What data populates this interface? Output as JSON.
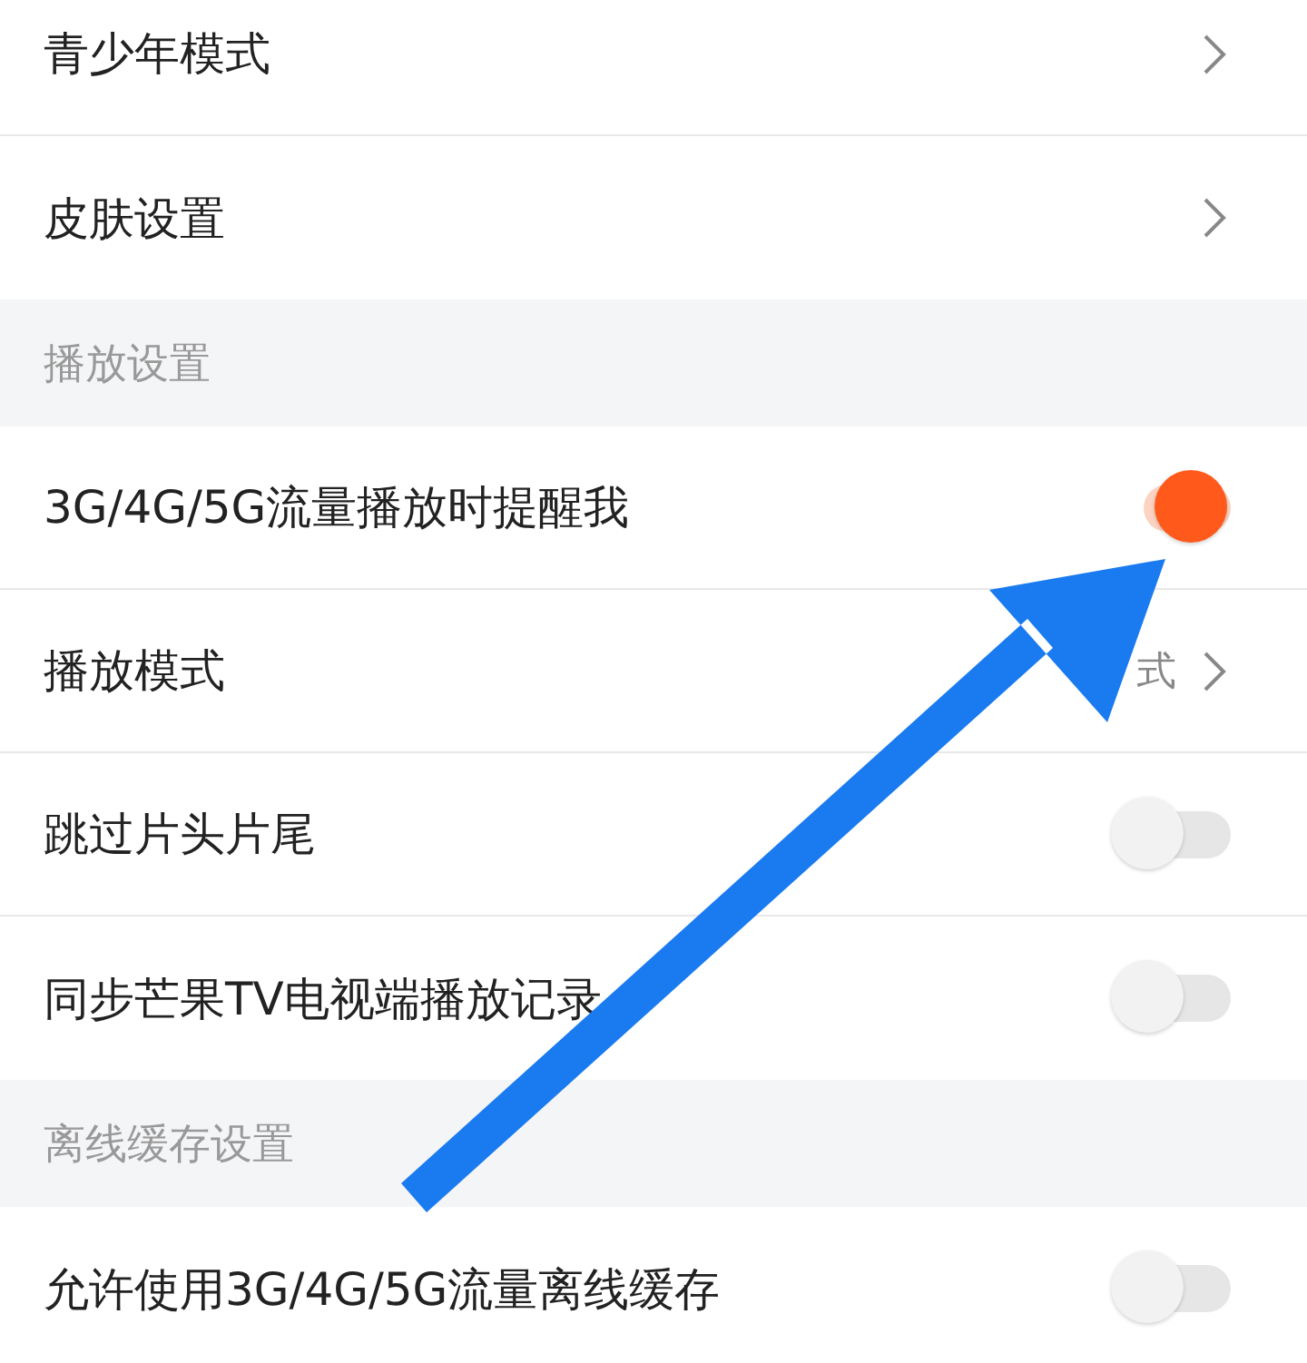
{
  "rows_top": [
    {
      "kind": "link",
      "label": "青少年模式"
    },
    {
      "kind": "link",
      "label": "皮肤设置"
    }
  ],
  "sections": [
    {
      "header": "播放设置",
      "rows": [
        {
          "kind": "toggle",
          "label": "3G/4G/5G流量播放时提醒我",
          "on": true
        },
        {
          "kind": "link",
          "label": "播放模式",
          "value": "式"
        },
        {
          "kind": "toggle",
          "label": "跳过片头片尾",
          "on": false
        },
        {
          "kind": "toggle",
          "label": "同步芒果TV电视端播放记录",
          "on": false
        }
      ]
    },
    {
      "header": "离线缓存设置",
      "rows": [
        {
          "kind": "toggle",
          "label": "允许使用3G/4G/5G流量离线缓存",
          "on": false
        }
      ]
    }
  ]
}
